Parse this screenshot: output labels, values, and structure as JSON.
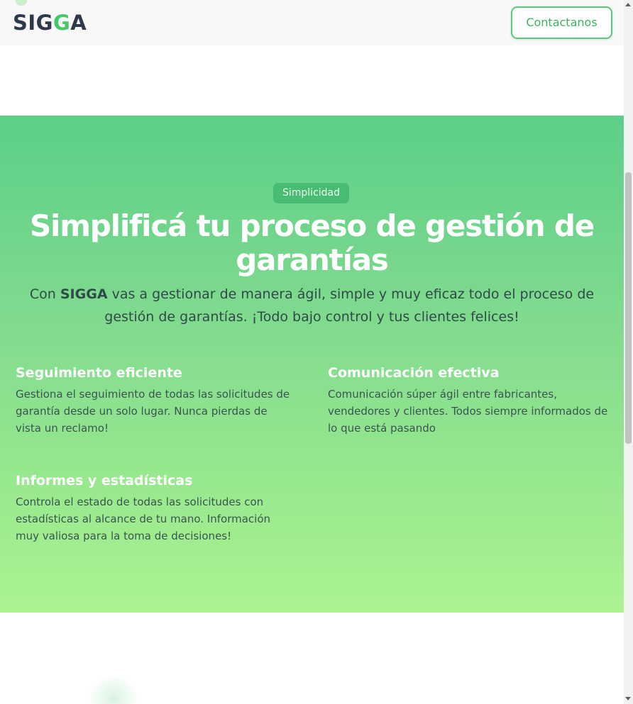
{
  "header": {
    "logo_prefix": "SIG",
    "logo_accent": "G",
    "logo_suffix": "A",
    "contact_label": "Contactanos"
  },
  "hero": {
    "badge": "Simplicidad",
    "title": "Simplificá tu proceso de gestión de garantías",
    "subtitle_before": "Con ",
    "subtitle_brand": "SIGGA",
    "subtitle_after": " vas a gestionar de manera ágil, simple y muy eficaz todo el proceso de gestión de garantías. ¡Todo bajo control y tus clientes felices!"
  },
  "features": [
    {
      "title": "Seguimiento eficiente",
      "text": "Gestiona el seguimiento de todas las solicitudes de garantía desde un solo lugar. Nunca pierdas de vista un reclamo!"
    },
    {
      "title": "Comunicación efectiva",
      "text": "Comunicación súper ágil entre fabricantes, vendedores y clientes. Todos siempre informados de lo que está pasando"
    },
    {
      "title": "Informes y estadísticas",
      "text": "Controla el estado de todas las solicitudes con estadísticas al alcance de tu mano. Información muy valiosa para la toma de decisiones!"
    }
  ],
  "colors": {
    "brand_green": "#45c869",
    "brand_dark": "#2e3a4c",
    "gradient_top": "#5ccf88",
    "gradient_bottom": "#abf38f"
  }
}
